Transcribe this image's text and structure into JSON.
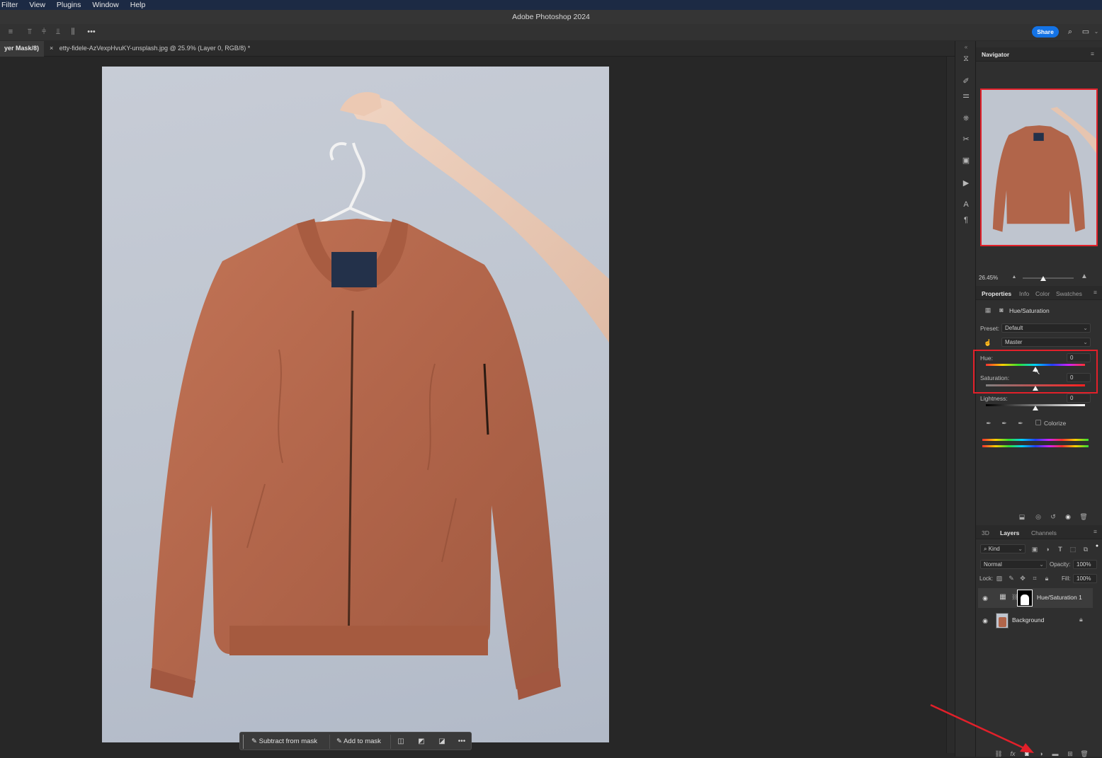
{
  "menu": {
    "items": [
      "Filter",
      "View",
      "Plugins",
      "Window",
      "Help"
    ]
  },
  "app_title": "Adobe Photoshop 2024",
  "optionsbar": {
    "share_label": "Share",
    "more_label": "•••"
  },
  "tabs": [
    {
      "label": "yer Mask/8) *"
    },
    {
      "label": "etty-fidele-AzVexpHvuKY-unsplash.jpg @ 25.9% (Layer 0, RGB/8) *",
      "close": "×"
    }
  ],
  "context_bar": {
    "subtract_label": "Subtract from mask",
    "add_label": "Add to mask",
    "more_label": "•••"
  },
  "navigator": {
    "title": "Navigator",
    "zoom": "26.45%"
  },
  "properties": {
    "tabs": [
      "Properties",
      "Info",
      "Color",
      "Swatches"
    ],
    "adjustment_name": "Hue/Saturation",
    "preset_label": "Preset:",
    "preset_value": "Default",
    "channel_value": "Master",
    "hue_label": "Hue:",
    "hue_value": "0",
    "saturation_label": "Saturation:",
    "saturation_value": "0",
    "lightness_label": "Lightness:",
    "lightness_value": "0",
    "colorize_label": "Colorize"
  },
  "layers_panel": {
    "tabs": [
      "3D",
      "Layers",
      "Channels"
    ],
    "filter_kind": "Kind",
    "blend_mode": "Normal",
    "opacity_label": "Opacity:",
    "opacity_value": "100%",
    "lock_label": "Lock:",
    "fill_label": "Fill:",
    "fill_value": "100%",
    "layers": [
      {
        "name": "Hue/Saturation 1"
      },
      {
        "name": "Background"
      }
    ],
    "footer_fx": "fx"
  },
  "colors": {
    "accent": "#1473e6",
    "highlight": "#e2202a",
    "jacket": "#b5684a"
  }
}
